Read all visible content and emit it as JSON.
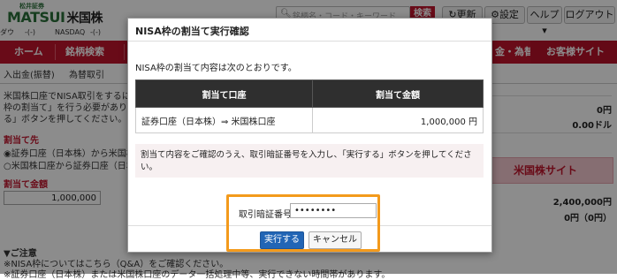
{
  "header": {
    "logo_small": "松井証券",
    "logo_brand": "MATSUI",
    "logo_jp": "米国株",
    "search_placeholder": "銘柄名・コード・キーワード",
    "search_label": "検索",
    "refresh_label": "更新",
    "settings_label": "設定",
    "help_label": "ヘルプ",
    "logout_label": "ログアウト"
  },
  "ticker": {
    "item1": "ダウ",
    "val1": "-(-)",
    "item2": "NASDAQ",
    "val2": "-(-)"
  },
  "nav": {
    "home": "ホーム",
    "stock_search": "銘柄検索",
    "deposit": "金・為替",
    "us_site": "お客様サイト"
  },
  "subnav": {
    "deposit_tab": "入出金(振替)",
    "fx_tab": "為替取引"
  },
  "background_left": {
    "line1": "米国株口座でNISA取引をするには",
    "line2": "枠の割当て」を行う必要があります",
    "line3": "る」ボタンを押してください。",
    "section_title": "割当て先",
    "option1": "証券口座（日本株）から米国株口",
    "option2": "米国株口座から証券口座（日本株",
    "amount_label": "割当て金額",
    "amount_value": "1,000,000",
    "notes_title": "▼ご注意",
    "note1": "※NISA枠についてはこちら（Q&A）をご確認ください。",
    "note2": "※証券口座（日本株）または米国株口座のデータ一括処理中等、実行できない時間帯があります。"
  },
  "background_right": {
    "val1": "0円",
    "val2": "0.00ドル",
    "us_site_button": "米国株サイト",
    "val3": "2,400,000円",
    "val4": "0円（0円）"
  },
  "modal": {
    "title": "NISA枠の割当て実行確認",
    "intro": "NISA枠の割当て内容は次のとおりです。",
    "table": {
      "headers": [
        "割当て口座",
        "割当て金額"
      ],
      "row": {
        "account": "証券口座（日本株）⇒ 米国株口座",
        "amount": "1,000,000 円"
      }
    },
    "notice": "割当て内容をご確認のうえ、取引暗証番号を入力し、「実行する」ボタンを押してください。",
    "password_label": "取引暗証番号",
    "password_value": "••••••••",
    "execute_label": "実行する",
    "cancel_label": "キャンセル"
  },
  "colors": {
    "brand_red": "#c0152d",
    "primary_blue": "#2265b5",
    "highlight_orange": "#f39a1c"
  }
}
